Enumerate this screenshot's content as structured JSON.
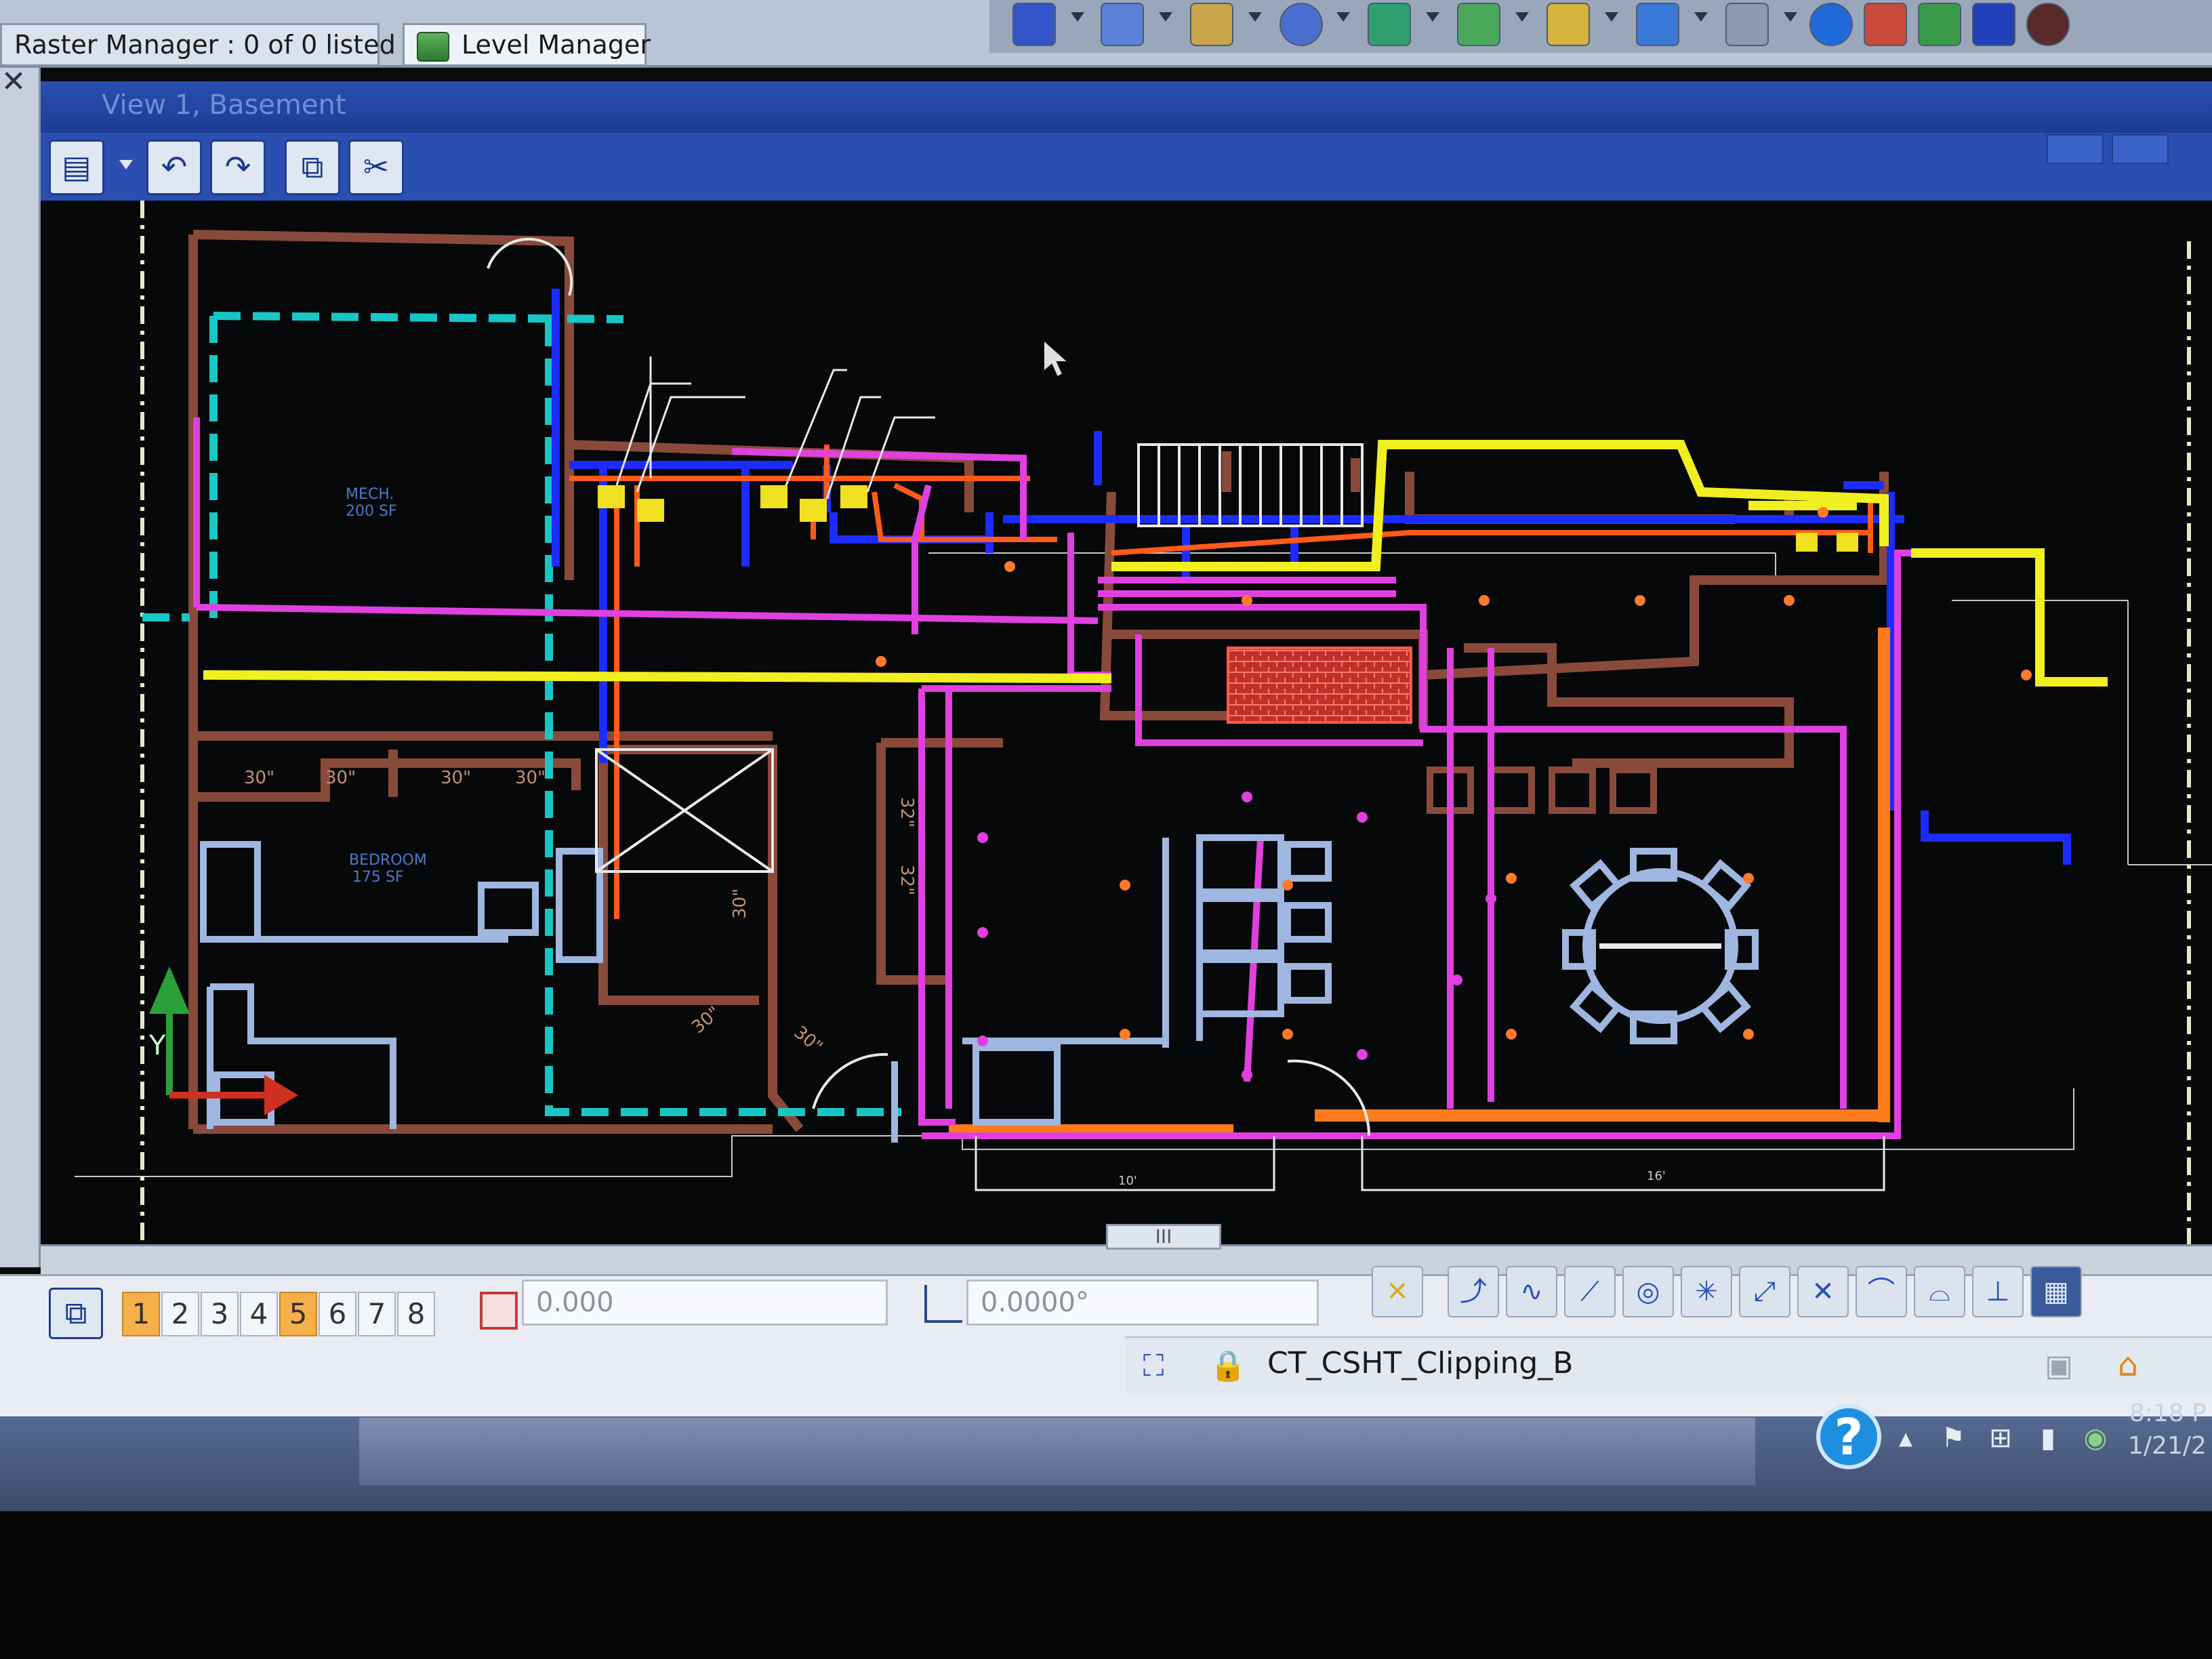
{
  "dock": {
    "raster_manager_label": "Raster Manager : 0 of 0 listed",
    "level_manager_label": "Level Manager"
  },
  "view": {
    "title": "View 1, Basement"
  },
  "plan": {
    "room_top_left_label": "MECH.",
    "room_top_left_area": "200 SF",
    "bedroom_label": "BEDROOM",
    "bedroom_area": "175 SF",
    "dim_30_a": "30\"",
    "dim_30_b": "30\"",
    "dim_30_c": "30\"",
    "dim_30_d": "30\"",
    "dim_30_bath": "30\"",
    "dim_30_diag_a": "30\"",
    "dim_30_diag_b": "30\"",
    "dim_32_a": "32\"",
    "dim_32_b": "32\"",
    "dim_10": "10'",
    "dim_16": "16'"
  },
  "bottom": {
    "view_numbers": [
      "1",
      "2",
      "3",
      "4",
      "5",
      "6",
      "7",
      "8"
    ],
    "distance_value": "0.000",
    "angle_value": "0.0000°",
    "status_text": "CT_CSHT_Clipping_B",
    "scroll_grip": "III"
  },
  "tray": {
    "time": "8:18 P",
    "date": "1/21/2"
  },
  "colors": {
    "canvas_bg": "#07080a",
    "wall_brown": "#8a4a3a",
    "cyan": "#19c6c6",
    "blue": "#1a2cff",
    "magenta": "#e040e0",
    "yellow": "#f0f020",
    "orange": "#ff7a1a",
    "light_blue": "#9fb6e0",
    "white": "#e8e8e8"
  }
}
